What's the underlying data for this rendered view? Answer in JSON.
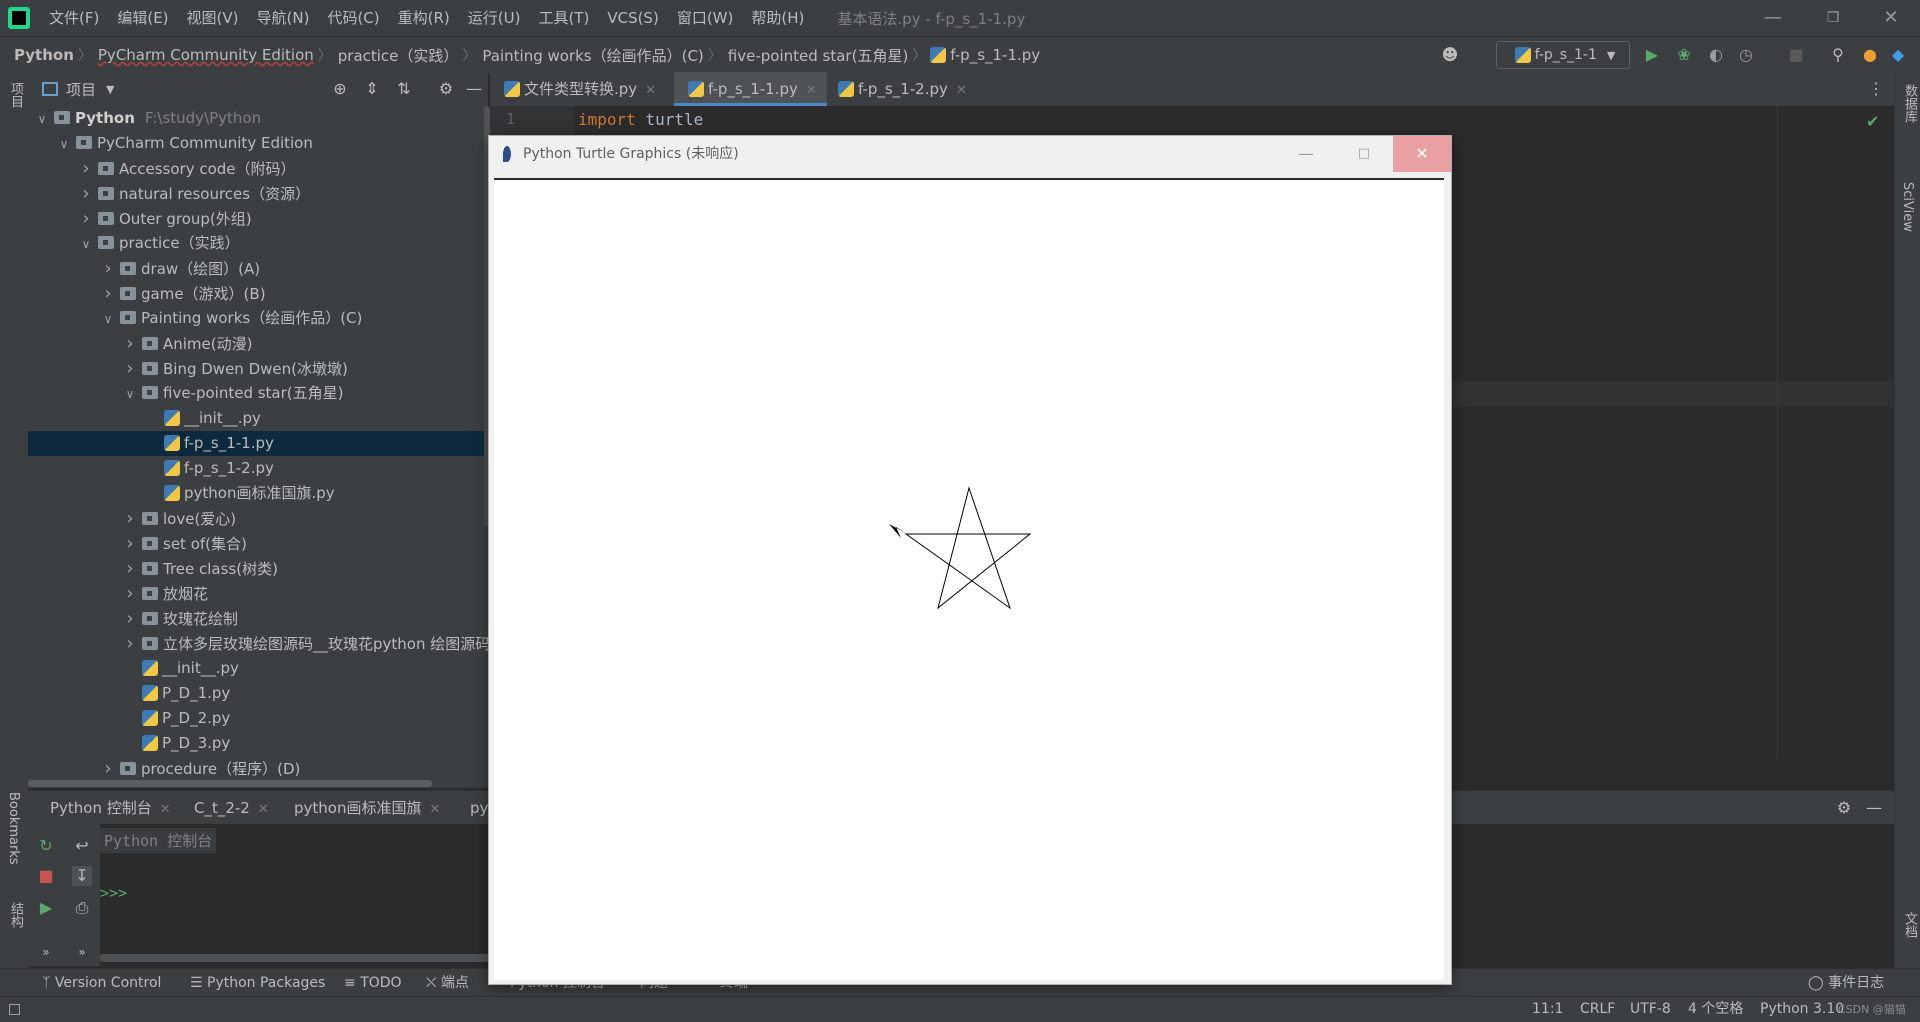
{
  "menubar": {
    "items": [
      "文件(F)",
      "编辑(E)",
      "视图(V)",
      "导航(N)",
      "代码(C)",
      "重构(R)",
      "运行(U)",
      "工具(T)",
      "VCS(S)",
      "窗口(W)",
      "帮助(H)"
    ],
    "window_title": "基本语法.py - f-p_s_1-1.py"
  },
  "breadcrumbs": [
    "Python",
    "PyCharm Community Edition",
    "practice（实践）",
    "Painting works（绘画作品）(C)",
    "five-pointed star(五角星)",
    "f-p_s_1-1.py"
  ],
  "run_config": "f-p_s_1-1",
  "left_strip": {
    "project": "项目",
    "bookmarks": "Bookmarks",
    "structure": "结构"
  },
  "right_strip": {
    "database": "数据库",
    "sciview": "SciView",
    "docs": "文档"
  },
  "project": {
    "title": "项目",
    "tree": [
      {
        "depth": 0,
        "chev": "down",
        "icon": "folder",
        "label": "Python",
        "path": "F:\\study\\Python",
        "bold": true
      },
      {
        "depth": 1,
        "chev": "down",
        "icon": "folder",
        "label": "PyCharm Community Edition"
      },
      {
        "depth": 2,
        "chev": "right",
        "icon": "folder",
        "label": "Accessory code（附码）"
      },
      {
        "depth": 2,
        "chev": "right",
        "icon": "folder",
        "label": "natural resources（资源）"
      },
      {
        "depth": 2,
        "chev": "right",
        "icon": "folder",
        "label": "Outer group(外组)"
      },
      {
        "depth": 2,
        "chev": "down",
        "icon": "folder",
        "label": "practice（实践）"
      },
      {
        "depth": 3,
        "chev": "right",
        "icon": "folder",
        "label": "draw（绘图）(A)"
      },
      {
        "depth": 3,
        "chev": "right",
        "icon": "folder",
        "label": "game（游戏）(B)"
      },
      {
        "depth": 3,
        "chev": "down",
        "icon": "folder",
        "label": "Painting works（绘画作品）(C)"
      },
      {
        "depth": 4,
        "chev": "right",
        "icon": "folder",
        "label": "Anime(动漫)"
      },
      {
        "depth": 4,
        "chev": "right",
        "icon": "folder",
        "label": "Bing Dwen Dwen(冰墩墩)"
      },
      {
        "depth": 4,
        "chev": "down",
        "icon": "folder",
        "label": "five-pointed star(五角星)"
      },
      {
        "depth": 5,
        "chev": "none",
        "icon": "py",
        "label": "__init__.py"
      },
      {
        "depth": 5,
        "chev": "none",
        "icon": "py",
        "label": "f-p_s_1-1.py",
        "selected": true
      },
      {
        "depth": 5,
        "chev": "none",
        "icon": "py",
        "label": "f-p_s_1-2.py"
      },
      {
        "depth": 5,
        "chev": "none",
        "icon": "py",
        "label": "python画标准国旗.py"
      },
      {
        "depth": 4,
        "chev": "right",
        "icon": "folder",
        "label": "love(爱心)"
      },
      {
        "depth": 4,
        "chev": "right",
        "icon": "folder",
        "label": "set of(集合)"
      },
      {
        "depth": 4,
        "chev": "right",
        "icon": "folder",
        "label": "Tree class(树类)"
      },
      {
        "depth": 4,
        "chev": "right",
        "icon": "folder",
        "label": "放烟花"
      },
      {
        "depth": 4,
        "chev": "right",
        "icon": "folder",
        "label": "玫瑰花绘制"
      },
      {
        "depth": 4,
        "chev": "right",
        "icon": "folder",
        "label": "立体多层玫瑰绘图源码__玫瑰花python 绘图源码"
      },
      {
        "depth": 4,
        "chev": "none",
        "icon": "py",
        "label": "__init__.py"
      },
      {
        "depth": 4,
        "chev": "none",
        "icon": "py",
        "label": "P_D_1.py"
      },
      {
        "depth": 4,
        "chev": "none",
        "icon": "py",
        "label": "P_D_2.py"
      },
      {
        "depth": 4,
        "chev": "none",
        "icon": "py",
        "label": "P_D_3.py"
      },
      {
        "depth": 3,
        "chev": "right",
        "icon": "folder",
        "label": "procedure（程序）(D)"
      }
    ]
  },
  "editor": {
    "tabs": [
      {
        "label": "文件类型转换.py",
        "active": false
      },
      {
        "label": "f-p_s_1-1.py",
        "active": true
      },
      {
        "label": "f-p_s_1-2.py",
        "active": false
      }
    ],
    "line_number": "1",
    "code_keyword": "import",
    "code_rest": " turtle"
  },
  "bottom": {
    "tabs": [
      "Python 控制台",
      "C_t_2-2",
      "python画标准国旗",
      "py"
    ],
    "console_label": "Python 控制台",
    "prompt": ">>>"
  },
  "toolbar_bottom": {
    "items": [
      "Version Control",
      "Python Packages",
      "TODO",
      "端点",
      "Python 控制台",
      "问题",
      "终端"
    ],
    "event_log": "事件日志"
  },
  "status": {
    "position": "11:1",
    "line_sep": "CRLF",
    "encoding": "UTF-8",
    "indent": "4 个空格",
    "interpreter": "Python 3.10",
    "watermark": "CSDN @猫猫"
  },
  "turtle": {
    "title": "Python Turtle Graphics (未响应)",
    "star": {
      "stroke": "#000000"
    }
  },
  "colors": {
    "accent": "#4a88c7",
    "selection": "#0d293e",
    "run_green": "#59a869",
    "keyword": "#cc7832"
  }
}
